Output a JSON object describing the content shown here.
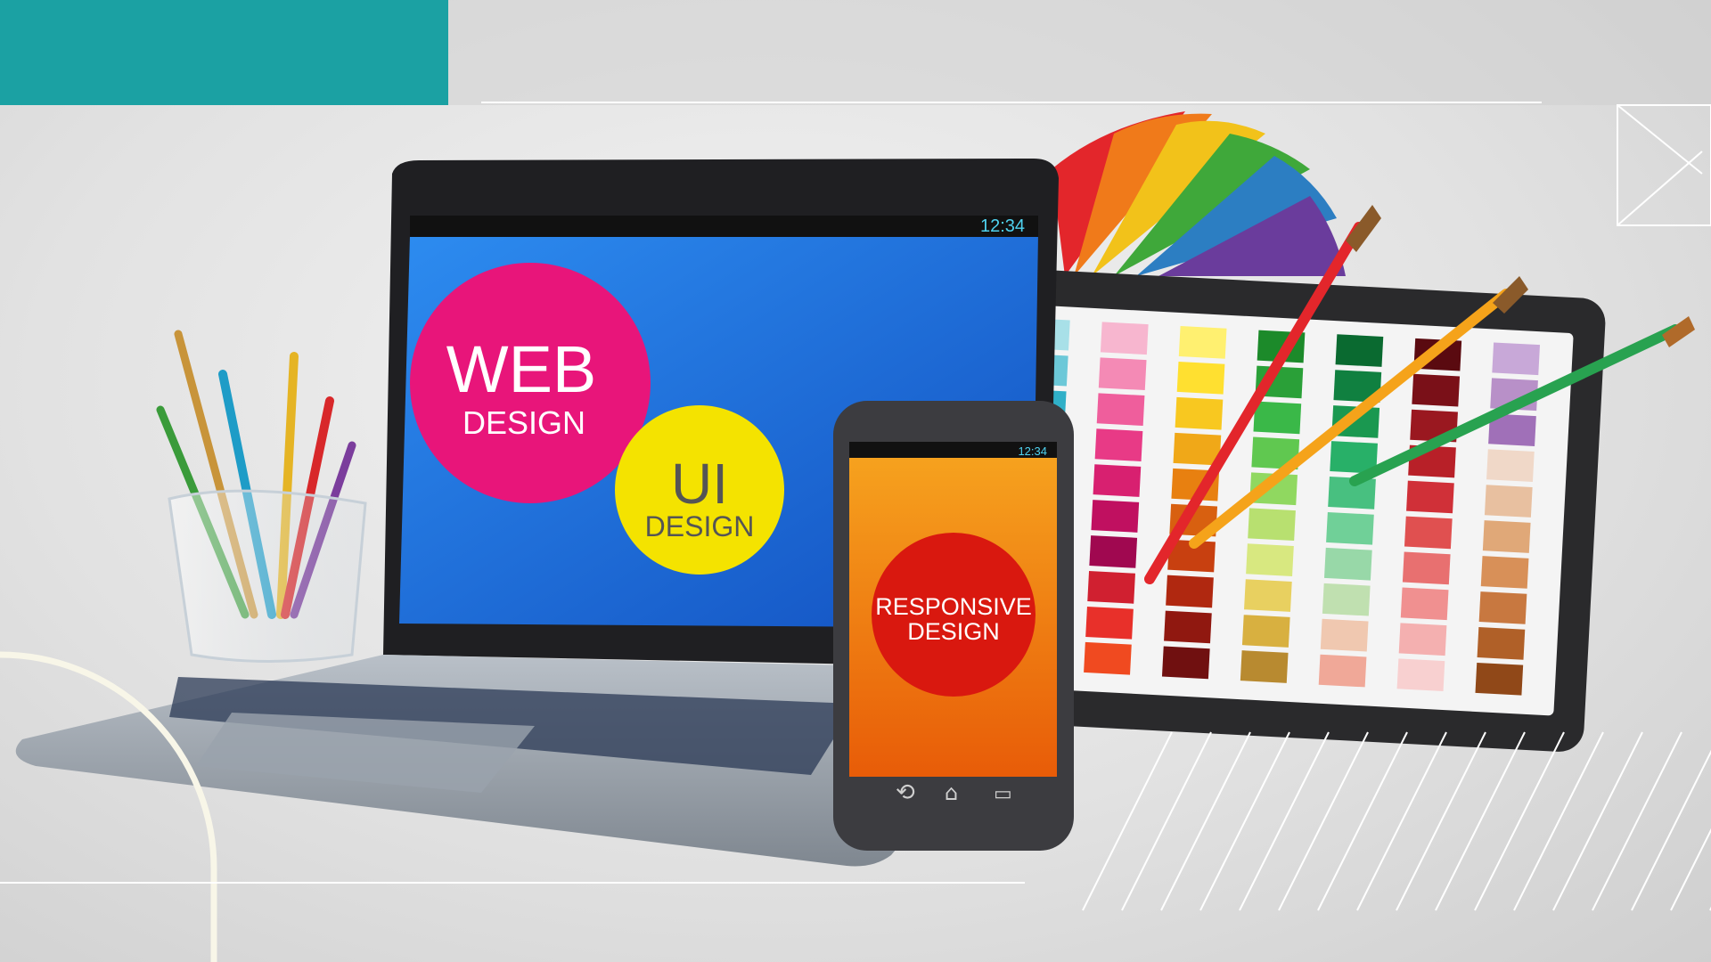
{
  "laptop": {
    "status_time": "12:34",
    "badge_web": {
      "line1": "WEB",
      "line2": "DESIGN"
    },
    "badge_ui": {
      "line1": "UI",
      "line2": "DESIGN"
    }
  },
  "phone": {
    "status_time": "12:34",
    "badge": {
      "line1": "RESPONSIVE",
      "line2": "DESIGN"
    }
  },
  "colors": {
    "teal": "#1ba1a3",
    "web_badge": "#e8157a",
    "ui_badge": "#f4e300",
    "responsive_badge": "#d9180f",
    "laptop_screen": "#1f78e6",
    "phone_screen": "#f07a10"
  }
}
